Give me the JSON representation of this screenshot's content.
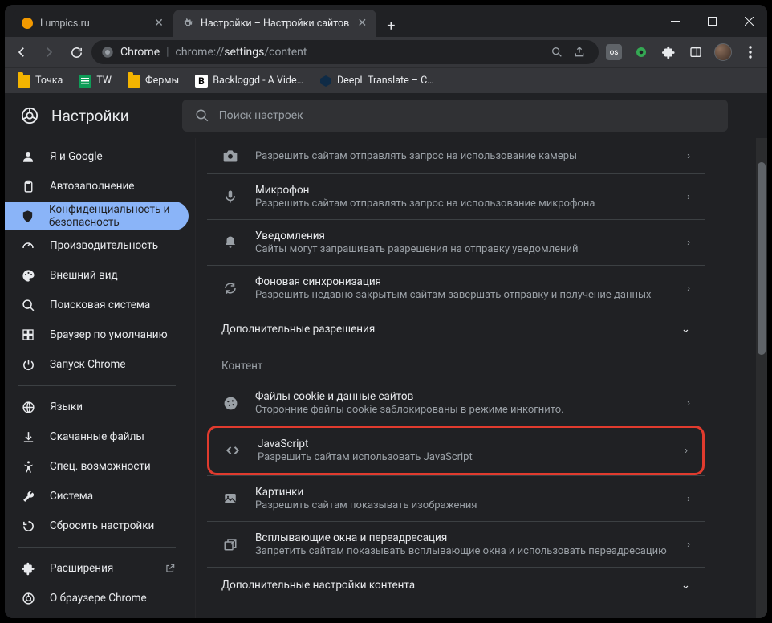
{
  "tabs": [
    {
      "title": "Lumpics.ru",
      "favicon_color": "#f29900"
    },
    {
      "title": "Настройки – Настройки сайтов"
    }
  ],
  "omnibox": {
    "scheme_label": "Chrome",
    "url_prefix": "chrome://",
    "url_highlight": "settings",
    "url_suffix": "/content"
  },
  "bookmarks": [
    {
      "label": "Точка",
      "type": "folder"
    },
    {
      "label": "TW",
      "type": "sheets"
    },
    {
      "label": "Фермы",
      "type": "folder"
    },
    {
      "label": "Backloggd - A Vide…",
      "type": "b"
    },
    {
      "label": "DeepL Translate – C…",
      "type": "deepl"
    }
  ],
  "settings": {
    "title": "Настройки",
    "search_placeholder": "Поиск настроек"
  },
  "sidebar": [
    {
      "id": "you-and-google",
      "label": "Я и Google",
      "icon": "person"
    },
    {
      "id": "autofill",
      "label": "Автозаполнение",
      "icon": "clipboard"
    },
    {
      "id": "privacy",
      "label": "Конфиденциальность и безопасность",
      "icon": "shield",
      "active": true
    },
    {
      "id": "performance",
      "label": "Производительность",
      "icon": "speed"
    },
    {
      "id": "appearance",
      "label": "Внешний вид",
      "icon": "palette"
    },
    {
      "id": "search",
      "label": "Поисковая система",
      "icon": "search"
    },
    {
      "id": "default",
      "label": "Браузер по умолчанию",
      "icon": "grid"
    },
    {
      "id": "startup",
      "label": "Запуск Chrome",
      "icon": "power"
    },
    {
      "divider": true
    },
    {
      "id": "languages",
      "label": "Языки",
      "icon": "globe"
    },
    {
      "id": "downloads",
      "label": "Скачанные файлы",
      "icon": "download"
    },
    {
      "id": "accessibility",
      "label": "Спец. возможности",
      "icon": "accessibility"
    },
    {
      "id": "system",
      "label": "Система",
      "icon": "wrench"
    },
    {
      "id": "reset",
      "label": "Сбросить настройки",
      "icon": "reset"
    },
    {
      "divider": true
    },
    {
      "id": "extensions",
      "label": "Расширения",
      "icon": "extension",
      "external": true
    },
    {
      "id": "about",
      "label": "О браузере Chrome",
      "icon": "chrome"
    }
  ],
  "rows_top": [
    {
      "icon": "camera",
      "title": "",
      "sub": "Разрешить сайтам отправлять запрос на использование камеры"
    },
    {
      "icon": "mic",
      "title": "Микрофон",
      "sub": "Разрешить сайтам отправлять запрос на использование микрофона"
    },
    {
      "icon": "bell",
      "title": "Уведомления",
      "sub": "Сайты могут запрашивать разрешения на отправку уведомлений"
    },
    {
      "icon": "sync",
      "title": "Фоновая синхронизация",
      "sub": "Разрешить недавно закрытым сайтам завершать отправку и получение данных"
    }
  ],
  "exp1": "Дополнительные разрешения",
  "content_label": "Контент",
  "rows_content": [
    {
      "icon": "cookie",
      "title": "Файлы cookie и данные сайтов",
      "sub": "Сторонние файлы cookie заблокированы в режиме инкогнито."
    },
    {
      "icon": "code",
      "title": "JavaScript",
      "sub": "Разрешить сайтам использовать JavaScript",
      "highlight": true
    },
    {
      "icon": "image",
      "title": "Картинки",
      "sub": "Разрешить сайтам показывать изображения"
    },
    {
      "icon": "popup",
      "title": "Всплывающие окна и переадресация",
      "sub": "Запретить сайтам показывать всплывающие окна и использовать переадресацию"
    }
  ],
  "exp2": "Дополнительные настройки контента"
}
